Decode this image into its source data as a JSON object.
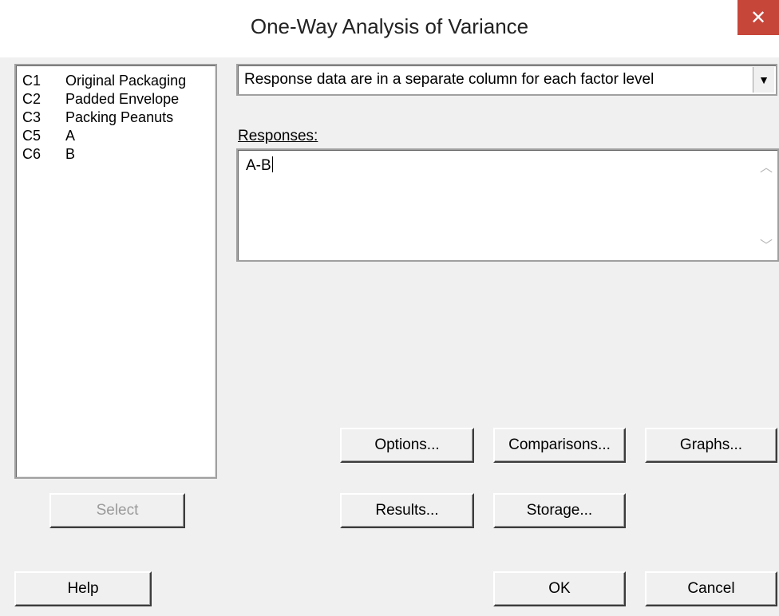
{
  "window": {
    "title": "One-Way Analysis of Variance",
    "close_label": "✕"
  },
  "variables": [
    {
      "col": "C1",
      "name": "Original Packaging"
    },
    {
      "col": "C2",
      "name": "Padded Envelope"
    },
    {
      "col": "C3",
      "name": "Packing Peanuts"
    },
    {
      "col": "C5",
      "name": "A"
    },
    {
      "col": "C6",
      "name": "B"
    }
  ],
  "layout_select": {
    "value": "Response data are in a separate column for each factor level"
  },
  "responses": {
    "label": "Responses:",
    "value": "A-B"
  },
  "buttons": {
    "select": "Select",
    "options": "Options...",
    "comparisons": "Comparisons...",
    "graphs": "Graphs...",
    "results": "Results...",
    "storage": "Storage...",
    "help": "Help",
    "ok": "OK",
    "cancel": "Cancel"
  }
}
